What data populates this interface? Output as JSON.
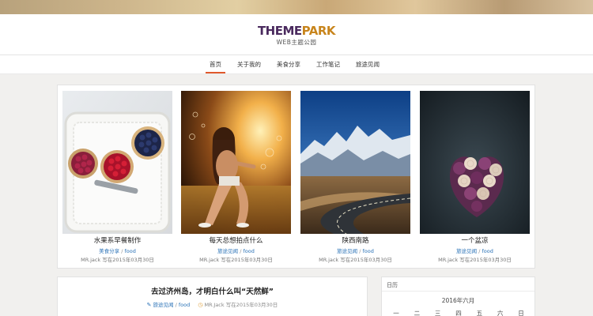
{
  "logo": {
    "main_a": "THEME",
    "main_b": "PARK",
    "sub": "WEB主题公园"
  },
  "nav": {
    "items": [
      "首页",
      "关于我的",
      "美食分享",
      "工作笔记",
      "旅途见闻"
    ],
    "active": 0
  },
  "featured": [
    {
      "title": "水果系早餐制作",
      "category": "美食分享",
      "tag": "food",
      "author": "MR.jack",
      "date": "写在2015年03月30日"
    },
    {
      "title": "每天总想拍点什么",
      "category": "旅途见闻",
      "tag": "food",
      "author": "MR.jack",
      "date": "写在2015年03月30日"
    },
    {
      "title": "陕西南路",
      "category": "旅途见闻",
      "tag": "food",
      "author": "MR.jack",
      "date": "写在2015年03月30日"
    },
    {
      "title": "一个盆凉",
      "category": "旅途见闻",
      "tag": "food",
      "author": "MR.jack",
      "date": "写在2015年03月30日"
    }
  ],
  "post": {
    "title": "去过济州岛，才明白什么叫“天然鲜”",
    "category": "旅途见闻",
    "tag": "food",
    "author": "MR.Jack",
    "date": "写在2015年03月30日"
  },
  "sidebar": {
    "title": "日历",
    "calendar_caption": "2016年六月",
    "weekdays": [
      "一",
      "二",
      "三",
      "四",
      "五",
      "六",
      "日"
    ]
  },
  "colors": {
    "accent": "#e0592c",
    "link": "#2a72b7",
    "logo_purple": "#4a2a5e",
    "logo_gold": "#c8851d"
  }
}
